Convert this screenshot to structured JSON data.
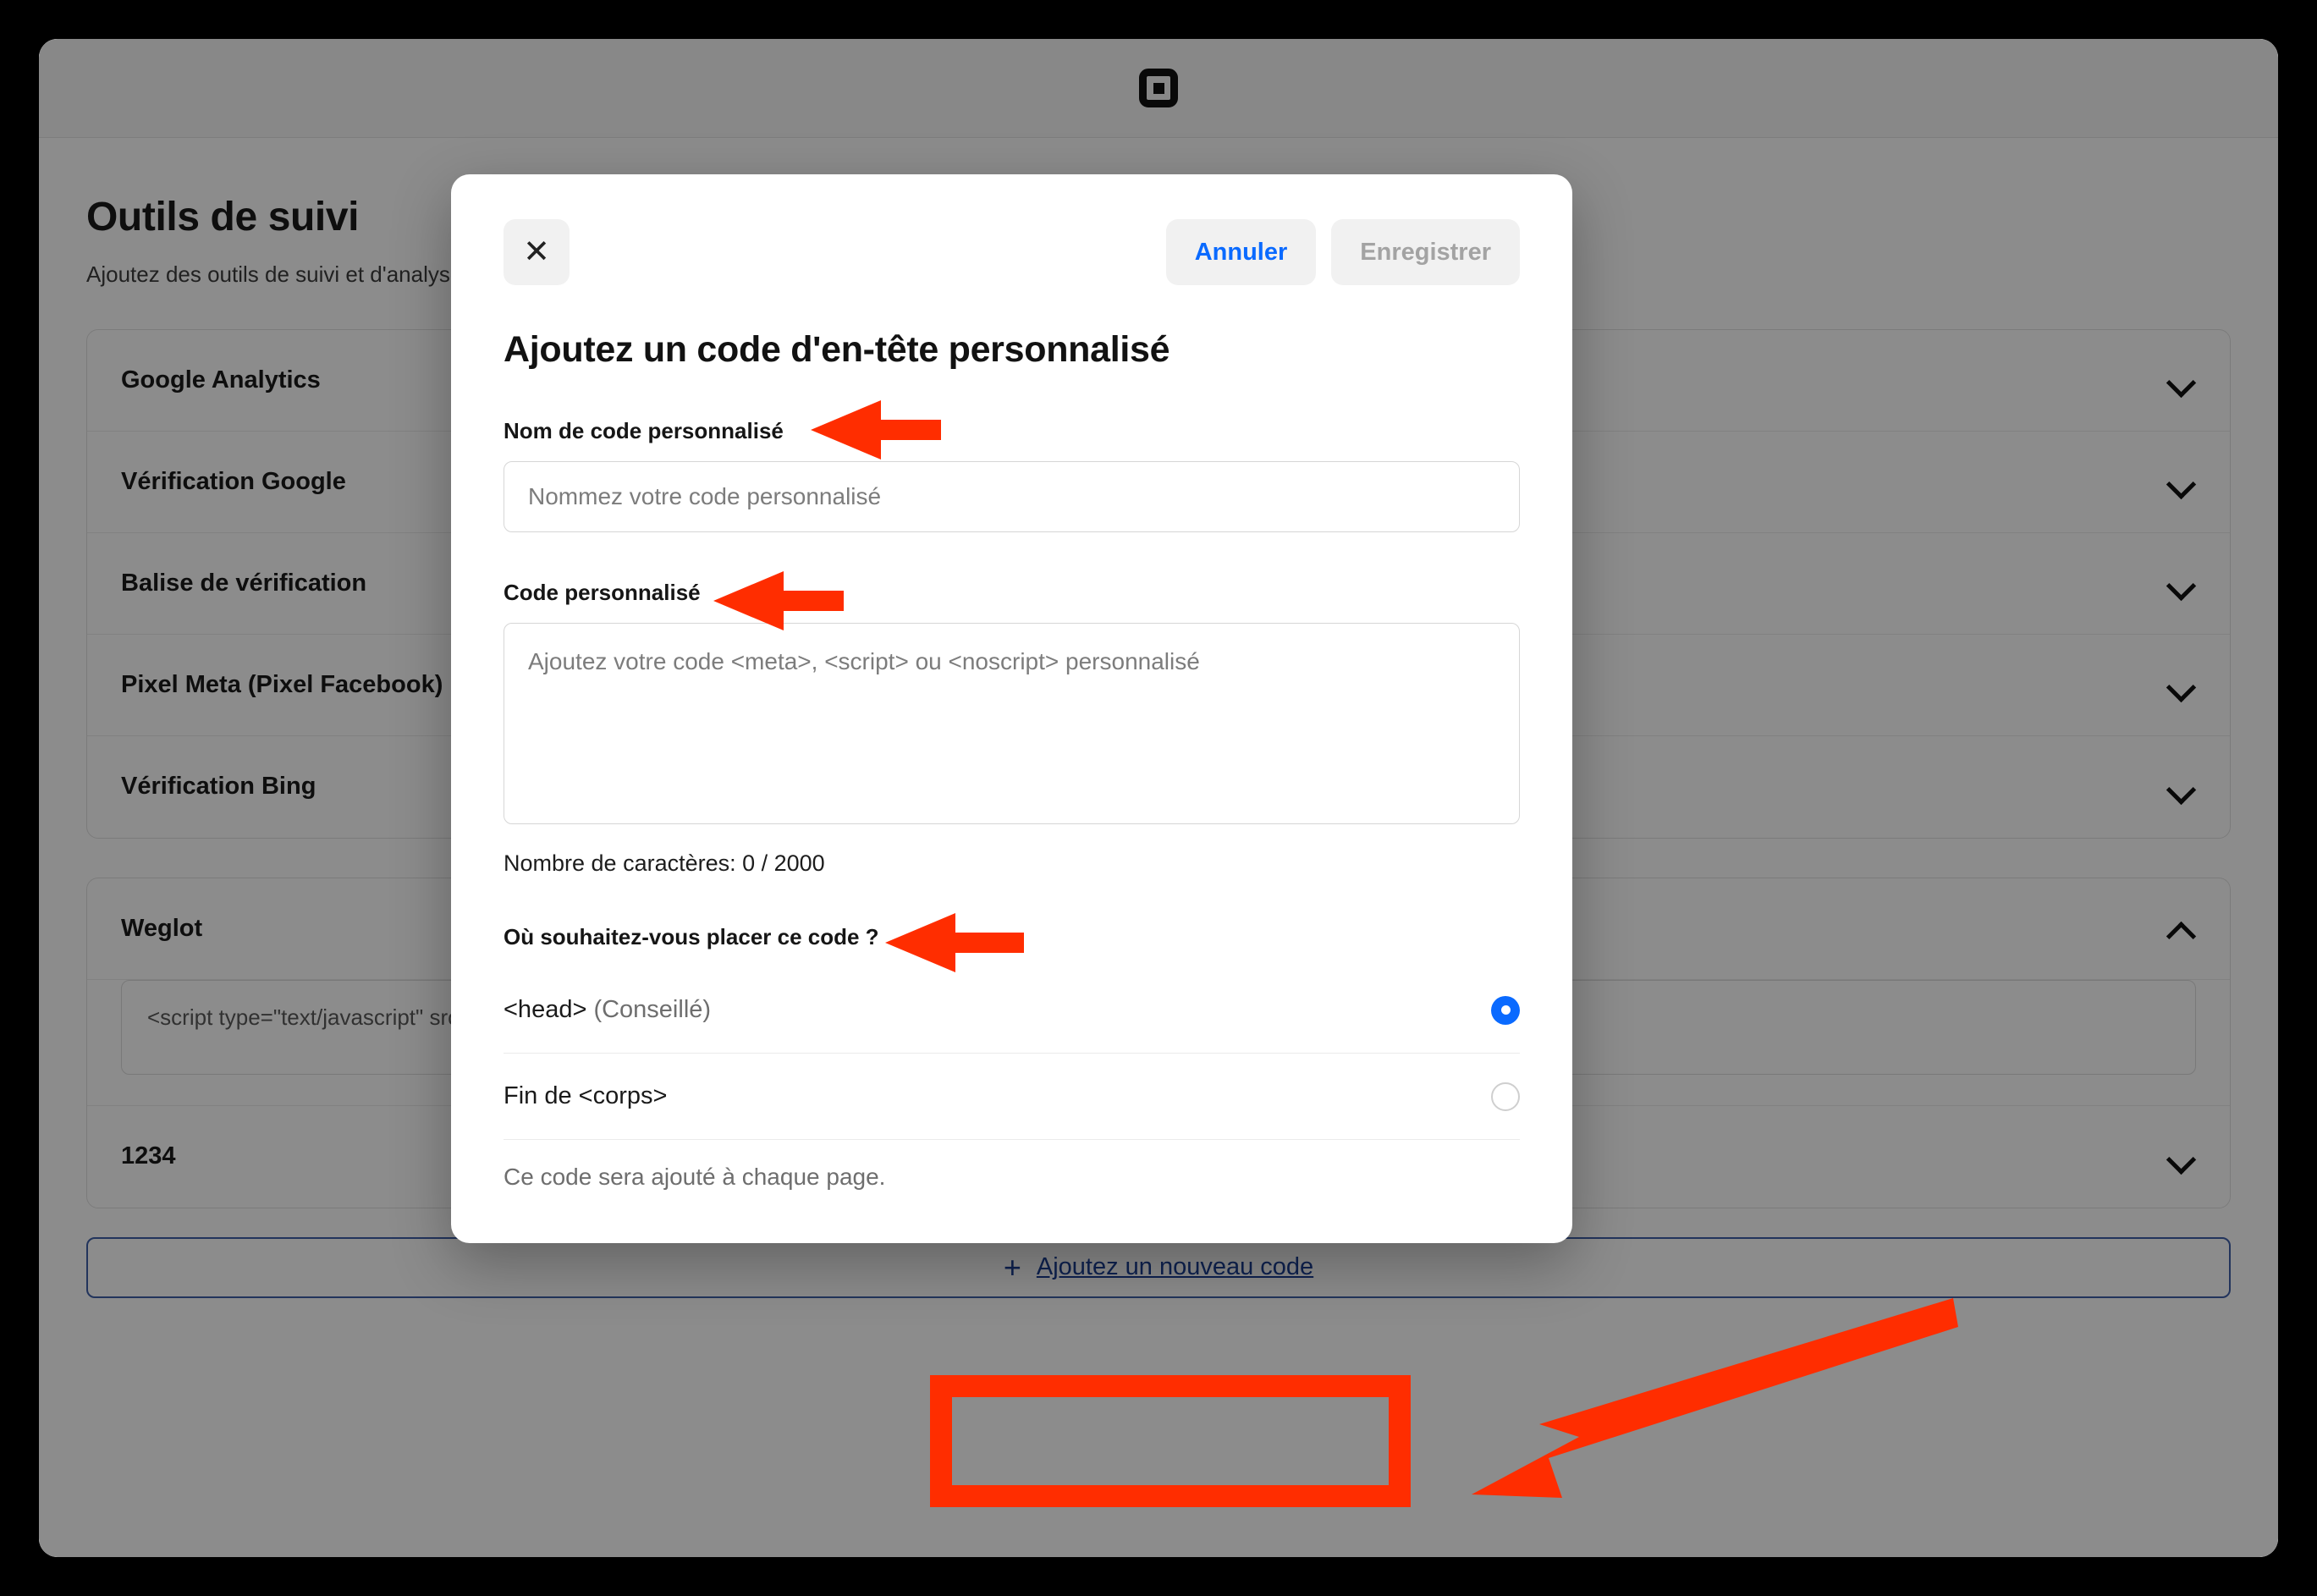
{
  "browser": {
    "logo_icon": "square-logo"
  },
  "page": {
    "title": "Outils de suivi",
    "subtitle": "Ajoutez des outils de suivi et d'analyse pour mieux comprendre le comportement des visiteurs et affiner votre marketing ciblé.",
    "tracking_tools": [
      {
        "label": "Google Analytics",
        "chevron": "chevron-down-icon"
      },
      {
        "label": "Vérification Google",
        "chevron": "chevron-down-icon"
      },
      {
        "label": "Balise de vérification",
        "chevron": "chevron-down-icon"
      },
      {
        "label": "Pixel Meta (Pixel Facebook)",
        "chevron": "chevron-down-icon"
      },
      {
        "label": "Vérification Bing",
        "chevron": "chevron-down-icon"
      }
    ],
    "custom_codes": [
      {
        "label": "Weglot",
        "chevron": "chevron-up-icon",
        "expanded": true,
        "code": "<script type=\"text/javascript\" src=\"https://cdn.weglot.com/weglot.min.js\"></script>"
      },
      {
        "label": "1234",
        "chevron": "chevron-down-icon",
        "expanded": false
      }
    ],
    "add_code_button": {
      "plus_icon": "plus-icon",
      "label": "Ajoutez un nouveau code"
    }
  },
  "modal": {
    "close_icon": "close-icon",
    "close_glyph": "✕",
    "cancel_label": "Annuler",
    "save_label": "Enregistrer",
    "title": "Ajoutez un code d'en-tête personnalisé",
    "name_field": {
      "label": "Nom de code personnalisé",
      "value": "",
      "placeholder": "Nommez votre code personnalisé"
    },
    "code_field": {
      "label": "Code personnalisé",
      "value": "",
      "placeholder": "Ajoutez votre code <meta>, <script> ou <noscript> personnalisé"
    },
    "char_count": "Nombre de caractères: 0 / 2000",
    "placement": {
      "label": "Où souhaitez-vous placer ce code ?",
      "options": [
        {
          "label": "<head>",
          "hint": " (Conseillé)",
          "selected": true
        },
        {
          "label": "Fin de <corps>",
          "hint": "",
          "selected": false
        }
      ],
      "note": "Ce code sera ajouté à chaque page."
    }
  },
  "annotations": {
    "arrow_color": "#FF2D00",
    "highlight_color": "#FF2D00",
    "items": [
      {
        "name": "arrow-to-name-label",
        "type": "arrow-left"
      },
      {
        "name": "arrow-to-code-label",
        "type": "arrow-left"
      },
      {
        "name": "arrow-to-placement-label",
        "type": "arrow-left"
      },
      {
        "name": "arrow-to-add-code-button",
        "type": "arrow-diagonal"
      },
      {
        "name": "highlight-box-add-code-button",
        "type": "rect-outline"
      }
    ]
  },
  "colors": {
    "accent_blue": "#0a6aff",
    "link_blue": "#1b3f94",
    "annotation_red": "#FF2D00",
    "scrim": "rgba(0,0,0,0.45)"
  }
}
